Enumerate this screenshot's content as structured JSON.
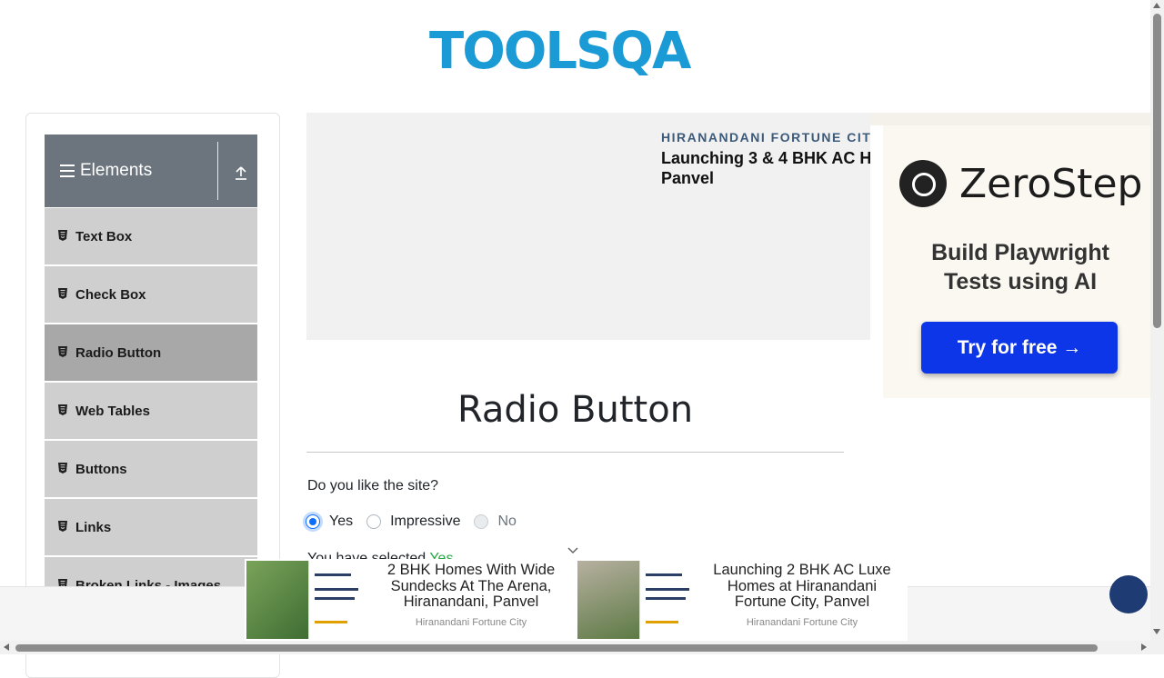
{
  "header": {
    "logo_text": "TOOLSQA"
  },
  "sidebar": {
    "group_title": "Elements",
    "items": [
      {
        "label": "Text Box",
        "active": false
      },
      {
        "label": "Check Box",
        "active": false
      },
      {
        "label": "Radio Button",
        "active": true
      },
      {
        "label": "Web Tables",
        "active": false
      },
      {
        "label": "Buttons",
        "active": false
      },
      {
        "label": "Links",
        "active": false
      },
      {
        "label": "Broken Links - Images",
        "active": false
      }
    ]
  },
  "ad_top": {
    "brand": "HIRANANDANI FORTUNE CITY",
    "headline": "Launching 3 & 4 BHK AC H Panvel"
  },
  "right_ad": {
    "brand": "ZeroStep",
    "tagline": "Build Playwright Tests using AI",
    "cta": "Try for free →"
  },
  "main": {
    "title": "Radio Button",
    "question": "Do you like the site?",
    "options": [
      {
        "label": "Yes",
        "checked": true,
        "disabled": false
      },
      {
        "label": "Impressive",
        "checked": false,
        "disabled": false
      },
      {
        "label": "No",
        "checked": false,
        "disabled": true
      }
    ],
    "selected_prefix": "You have selected",
    "selected_value": "Yes"
  },
  "bottom_ads": [
    {
      "text": "2 BHK Homes With Wide Sundecks At The Arena, Hiranandani, Panvel",
      "source": "Hiranandani Fortune City"
    },
    {
      "text": "Launching 2 BHK AC Luxe Homes at Hiranandani Fortune City, Panvel",
      "source": "Hiranandani Fortune City"
    }
  ],
  "colors": {
    "accent": "#0d6efd",
    "selected_value": "#28a745",
    "sidebar_header": "#6c757d",
    "cta": "#0d36e8",
    "logo": "#1b9bd6"
  },
  "icons": {
    "menu": "hamburger-icon",
    "collapse": "upload-icon",
    "item": "html5-icon",
    "chevron": "chevron-down-icon"
  }
}
